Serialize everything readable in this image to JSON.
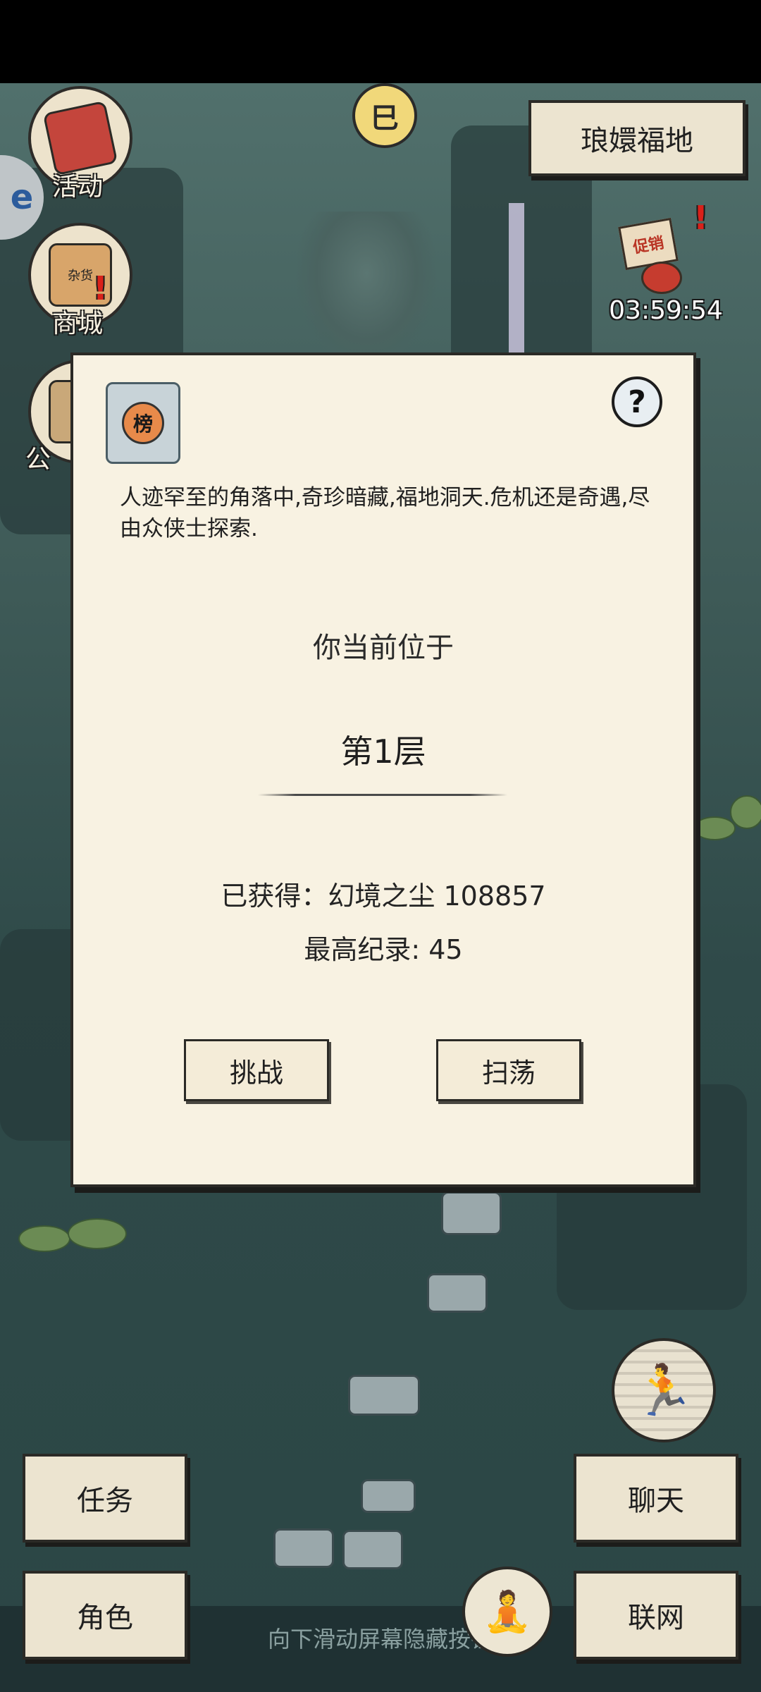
{
  "top": {
    "sun_glyph": "巳",
    "location_button": "琅嬛福地",
    "promo_sign": "促销",
    "timer": "03:59:54",
    "side_tab_glyph": "e"
  },
  "left_menu": {
    "activity": {
      "label": "活动",
      "icon": "flag-icon"
    },
    "shop": {
      "label": "商城",
      "icon": "shop-icon",
      "sign": "杂货"
    },
    "third": {
      "label": "公",
      "icon": "pavilion-icon"
    }
  },
  "dialog": {
    "badge_glyph": "榜",
    "help_glyph": "?",
    "description": "人迹罕至的角落中,奇珍暗藏,福地洞天.危机还是奇遇,尽由众侠士探索.",
    "location_label": "你当前位于",
    "floor": "第1层",
    "obtained": "已获得：幻境之尘 108857",
    "record": "最高纪录: 45",
    "challenge_button": "挑战",
    "sweep_button": "扫荡"
  },
  "bottom": {
    "quest_button": "任务",
    "chat_button": "聊天",
    "character_button": "角色",
    "network_button": "联网",
    "hint": "向下滑动屏幕隐藏按钮",
    "run_icon": "running-icon",
    "meditate_icon": "meditate-icon"
  },
  "colors": {
    "panel": "#f8f2e2",
    "button": "#ece4d0",
    "alert": "#d9211a",
    "water": "#2e4a4a"
  }
}
